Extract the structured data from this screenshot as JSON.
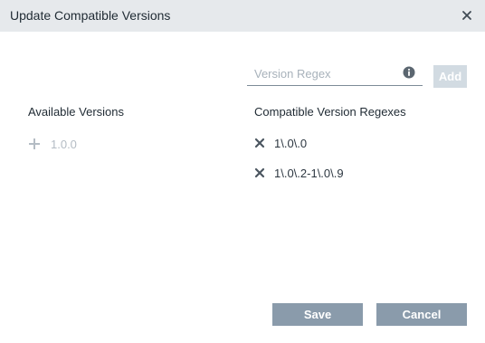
{
  "dialog": {
    "title": "Update Compatible Versions",
    "close_icon": "close-icon"
  },
  "regex_input": {
    "placeholder": "Version Regex",
    "value": "",
    "info_icon": "info-icon"
  },
  "add_button": {
    "label": "Add"
  },
  "available_versions": {
    "heading": "Available Versions",
    "items": [
      {
        "label": "1.0.0",
        "icon": "plus-icon"
      }
    ]
  },
  "compatible_regexes": {
    "heading": "Compatible Version Regexes",
    "items": [
      {
        "label": "1\\.0\\.0",
        "icon": "remove-icon"
      },
      {
        "label": "1\\.0\\.2-1\\.0\\.9",
        "icon": "remove-icon"
      }
    ]
  },
  "footer": {
    "save_label": "Save",
    "cancel_label": "Cancel"
  },
  "colors": {
    "header_bg": "#e6e9ec",
    "primary_button": "#8a9bab",
    "disabled_button": "#d2dbe2",
    "muted_text": "#b4bcc4"
  }
}
